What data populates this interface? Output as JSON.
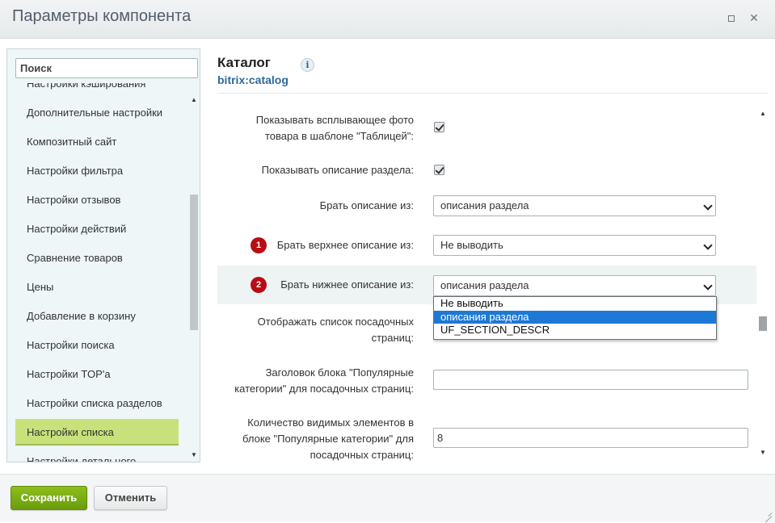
{
  "window": {
    "title": "Параметры компонента",
    "maximize_icon": "maximize-icon",
    "close_icon": "close-icon",
    "close_glyph": "✕"
  },
  "sidebar": {
    "search_placeholder": "Поиск",
    "items": [
      {
        "label": "Настройки кэширования"
      },
      {
        "label": "Дополнительные настройки"
      },
      {
        "label": "Композитный сайт"
      },
      {
        "label": "Настройки фильтра"
      },
      {
        "label": "Настройки отзывов"
      },
      {
        "label": "Настройки действий"
      },
      {
        "label": "Сравнение товаров"
      },
      {
        "label": "Цены"
      },
      {
        "label": "Добавление в корзину"
      },
      {
        "label": "Настройки поиска"
      },
      {
        "label": "Настройки TOP'а"
      },
      {
        "label": "Настройки списка разделов"
      },
      {
        "label": "Настройки списка",
        "active": true
      },
      {
        "label": "Настройки детального"
      }
    ],
    "scroll_up_glyph": "▲",
    "scroll_down_glyph": "▼"
  },
  "component": {
    "title": "Каталог",
    "code": "bitrix:catalog",
    "info_glyph": "i"
  },
  "params": {
    "popup_photo_label_line1": "Показывать всплывающее фото",
    "popup_photo_label_line2": "товара в шаблоне \"Таблицей\":",
    "popup_photo_checked": true,
    "show_section_desc_label": "Показывать описание раздела:",
    "show_section_desc_checked": true,
    "desc_from_label": "Брать описание из:",
    "desc_from_value": "описания раздела",
    "top_desc_badge": "1",
    "top_desc_label": "Брать верхнее описание из:",
    "top_desc_value": "Не выводить",
    "bottom_desc_badge": "2",
    "bottom_desc_label": "Брать нижнее описание из:",
    "bottom_desc_value": "описания раздела",
    "bottom_desc_options": [
      "Не выводить",
      "описания раздела",
      "UF_SECTION_DESCR"
    ],
    "bottom_desc_selected_index": 1,
    "landing_list_label_line1": "Отображать список посадочных",
    "landing_list_label_line2": "страниц:",
    "popular_title_label_line1": "Заголовок блока \"Популярные",
    "popular_title_label_line2": "категории\" для посадочных страниц:",
    "popular_title_value": "",
    "visible_count_label_line1": "Количество видимых элементов в",
    "visible_count_label_line2": "блоке \"Популярные категории\" для",
    "visible_count_label_line3": "посадочных страниц:",
    "visible_count_value": "8"
  },
  "footer": {
    "save_label": "Сохранить",
    "cancel_label": "Отменить"
  },
  "colors": {
    "accent_green": "#7aad14",
    "active_item": "#c8e27b",
    "badge_red": "#b80d14",
    "link_blue": "#2d6a9a",
    "selected_option": "#1e78d6"
  }
}
